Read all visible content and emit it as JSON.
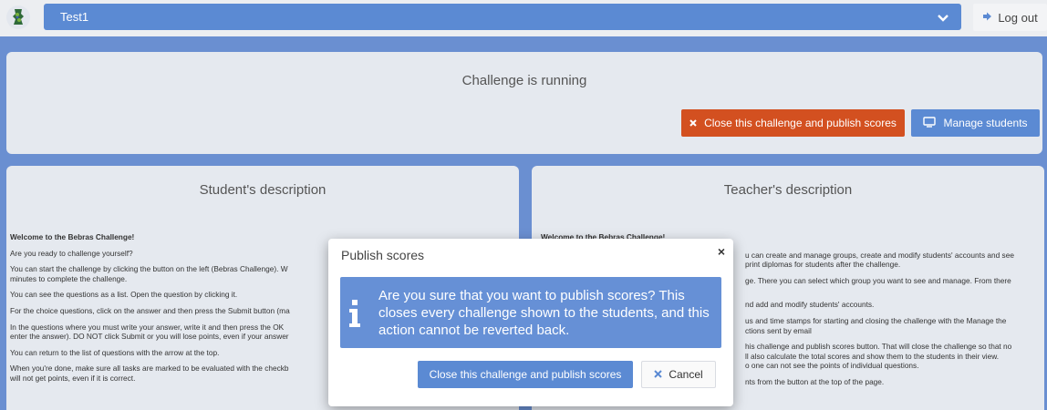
{
  "topbar": {
    "group_name": "Test1",
    "logout_label": "Log out"
  },
  "status": {
    "title": "Challenge is running",
    "close_button_label": "Close this challenge and publish scores",
    "manage_button_label": "Manage students"
  },
  "student": {
    "title": "Student's description",
    "paragraphs": [
      "Welcome to the Bebras Challenge!",
      "Are you ready to challenge yourself?",
      "You can start the challenge by clicking the button on the left (Bebras Challenge). W",
      "minutes to complete the challenge.",
      "You can see the questions as a list. Open the question by clicking it.",
      "For the choice questions, click on the answer and then press the Submit button (ma",
      "In the questions where you must write your answer, write it and then press the OK",
      "enter the answer). DO NOT click Submit or you will lose points, even if your answer",
      "You can return to the list of questions with the arrow at the top.",
      "When you're done, make sure all tasks are marked to be evaluated with the checkb",
      "will not get points, even if it is correct."
    ]
  },
  "teacher": {
    "title": "Teacher's description",
    "paragraphs": [
      "Welcome to the Bebras Challenge!",
      "u can create and manage groups, create and modify students' accounts and see",
      "print diplomas for students after the challenge.",
      "ge. There you can select which group you want to see and manage. From there",
      "nd add and modify students' accounts.",
      "us and time stamps for starting and closing the challenge with the Manage the",
      "ctions sent by email",
      "his challenge and publish scores button. That will close the challenge so that no",
      "ll also calculate the total scores and show them to the students in their view.",
      "o one can not see the points of individual questions.",
      "nts from the button at the top of the page."
    ]
  },
  "modal": {
    "title": "Publish scores",
    "close_symbol": "×",
    "message": "Are you sure that you want to publish scores? This closes every challenge shown to the students, and this action cannot be reverted back.",
    "confirm_label": "Close this challenge and publish scores",
    "cancel_label": "Cancel"
  },
  "colors": {
    "primary": "#5b8ad3",
    "danger": "#d35020",
    "alert_bg": "#6690d6",
    "backdrop": "#6a8fd1"
  },
  "icons": {
    "logo": "bebras-beaver-logo",
    "dropdown": "chevron-down-icon",
    "logout": "sign-out-icon",
    "close": "times-icon",
    "manage": "monitor-icon",
    "info": "info-icon"
  }
}
